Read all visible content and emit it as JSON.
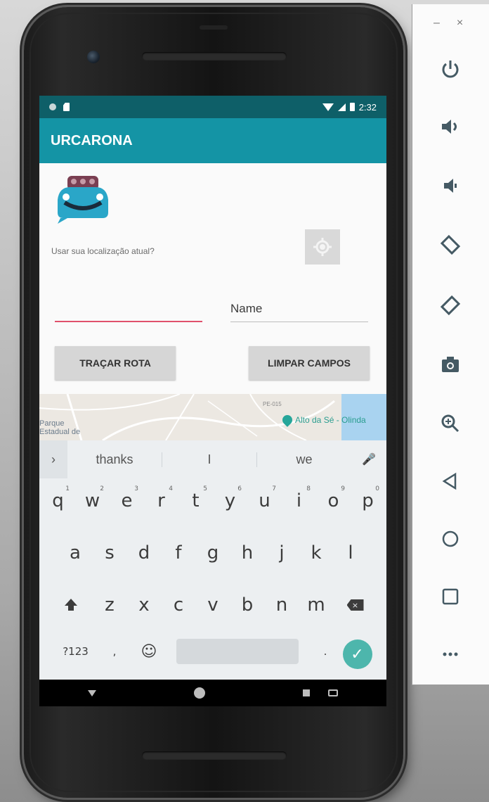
{
  "app": {
    "title": "URCARONA",
    "status_time": "2:32",
    "location_prompt": "Usar sua localização atual?",
    "name_placeholder": "Name",
    "route_button": "TRAÇAR ROTA",
    "clear_button": "LIMPAR CAMPOS"
  },
  "map": {
    "park_label": "Parque\nEstadual de",
    "poi_label": "Alto da Sé - Olinda",
    "road_label": "PE-015"
  },
  "keyboard": {
    "suggestions": [
      "thanks",
      "I",
      "we"
    ],
    "row1": [
      {
        "char": "q",
        "hint": "1"
      },
      {
        "char": "w",
        "hint": "2"
      },
      {
        "char": "e",
        "hint": "3"
      },
      {
        "char": "r",
        "hint": "4"
      },
      {
        "char": "t",
        "hint": "5"
      },
      {
        "char": "y",
        "hint": "6"
      },
      {
        "char": "u",
        "hint": "7"
      },
      {
        "char": "i",
        "hint": "8"
      },
      {
        "char": "o",
        "hint": "9"
      },
      {
        "char": "p",
        "hint": "0"
      }
    ],
    "row2": [
      "a",
      "s",
      "d",
      "f",
      "g",
      "h",
      "j",
      "k",
      "l"
    ],
    "row3": [
      "z",
      "x",
      "c",
      "v",
      "b",
      "n",
      "m"
    ],
    "symbols_key": "?123",
    "comma_key": ",",
    "emoji_key": "☺",
    "period_key": "."
  },
  "emulator_panel": {
    "minimize_label": "–",
    "close_label": "×",
    "controls": [
      "power-icon",
      "volume-up-icon",
      "volume-down-icon",
      "rotate-left-icon",
      "rotate-right-icon",
      "camera-icon",
      "zoom-icon",
      "back-icon",
      "home-icon",
      "overview-icon",
      "more-icon"
    ]
  },
  "colors": {
    "status_bar": "#0e5f68",
    "app_bar": "#1494a5",
    "accent_underline": "#e0506b",
    "enter_key": "#4db6ac"
  }
}
